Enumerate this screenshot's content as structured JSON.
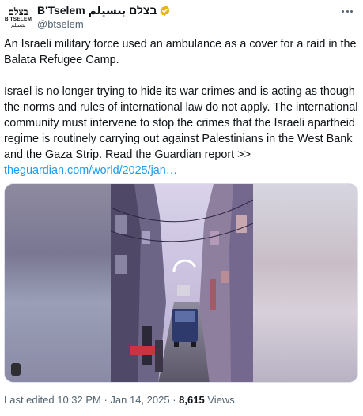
{
  "author": {
    "display_name": "B'Tselem בצלם بتسيلم",
    "handle": "@btselem",
    "avatar_hebrew": "בצלם",
    "avatar_latin": "B'TSELEM",
    "avatar_arabic": "بتسيلم",
    "verified_color": "#e8b41a"
  },
  "tweet": {
    "paragraph_1": "An Israeli military force used an ambulance as a cover for a raid in the Balata Refugee Camp.",
    "paragraph_2": "Israel is no longer trying to hide its war crimes and is acting as though the norms and rules of international law do not apply. The international community must intervene to stop the crimes that the Israeli apartheid regime is routinely carrying out against Palestinians in the West Bank and the Gaza Strip. Read the Guardian report >>",
    "link_text": "theguardian.com/world/2025/jan…"
  },
  "footer": {
    "edited_label": "Last edited 10:32 PM · Jan 14, 2025 ·",
    "views_count": "8,615",
    "views_label": "Views"
  },
  "colors": {
    "link": "#1d9bf0",
    "muted": "#536471",
    "text": "#0f1419"
  },
  "icons": [
    "verified-badge-icon",
    "more-options-icon",
    "loading-spinner-icon",
    "gif-indicator-icon"
  ]
}
